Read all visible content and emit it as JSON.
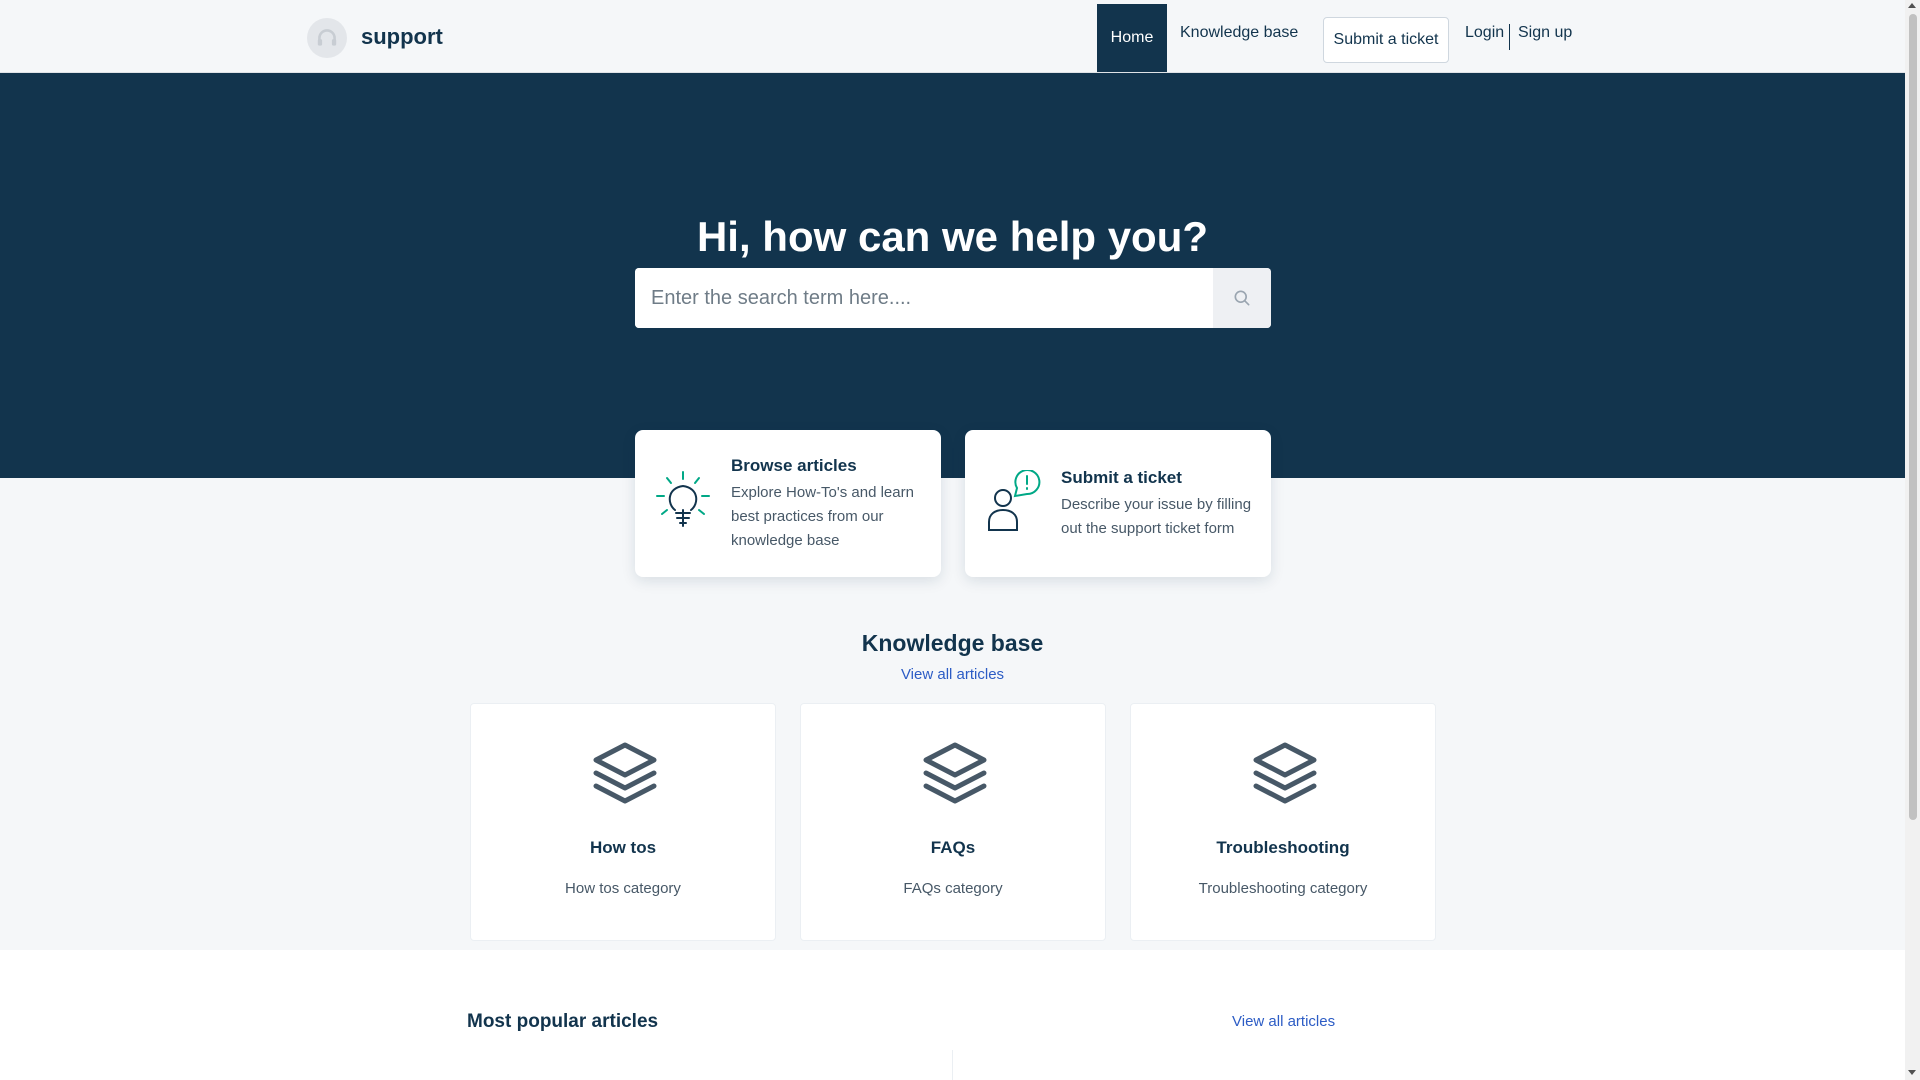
{
  "header": {
    "brand": "support",
    "nav": {
      "home": "Home",
      "knowledge_base": "Knowledge base",
      "submit_ticket": "Submit a ticket",
      "login": "Login",
      "signup": "Sign up"
    }
  },
  "hero": {
    "title": "Hi, how can we help you?",
    "search_placeholder": "Enter the search term here...."
  },
  "actions": [
    {
      "title": "Browse articles",
      "description": "Explore How-To's and learn best practices from our knowledge base",
      "icon": "lightbulb-icon"
    },
    {
      "title": "Submit a ticket",
      "description": "Describe your issue by filling out the support ticket form",
      "icon": "person-alert-icon"
    }
  ],
  "knowledge_base": {
    "title": "Knowledge base",
    "view_all": "View all articles",
    "categories": [
      {
        "name": "How tos",
        "description": "How tos category",
        "icon": "layers-icon"
      },
      {
        "name": "FAQs",
        "description": "FAQs category",
        "icon": "layers-icon"
      },
      {
        "name": "Troubleshooting",
        "description": "Troubleshooting category",
        "icon": "layers-icon"
      }
    ]
  },
  "popular": {
    "title": "Most popular articles",
    "view_all": "View all articles"
  },
  "colors": {
    "primary": "#12344d",
    "accent_green": "#00a886",
    "link": "#2c5cc5",
    "background": "#f5f7f9"
  }
}
